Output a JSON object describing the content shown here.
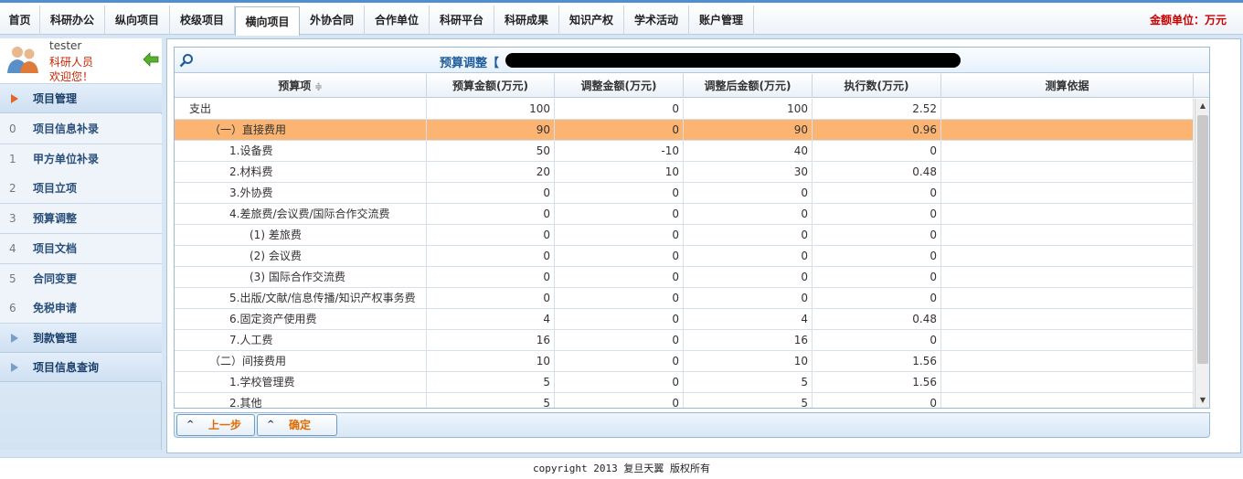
{
  "nav": {
    "tabs": [
      {
        "label": "首页"
      },
      {
        "label": "科研办公"
      },
      {
        "label": "纵向项目"
      },
      {
        "label": "校级项目"
      },
      {
        "label": "横向项目"
      },
      {
        "label": "外协合同"
      },
      {
        "label": "合作单位"
      },
      {
        "label": "科研平台"
      },
      {
        "label": "科研成果"
      },
      {
        "label": "知识产权"
      },
      {
        "label": "学术活动"
      },
      {
        "label": "账户管理"
      }
    ],
    "active_index": 4,
    "unit_label": "金额单位：万元"
  },
  "user": {
    "name": "tester",
    "role": "科研人员",
    "welcome": "欢迎您！"
  },
  "sidebar": {
    "section1": "项目管理",
    "items": [
      {
        "idx": "0",
        "label": "项目信息补录"
      },
      {
        "idx": "1",
        "label": "甲方单位补录"
      },
      {
        "idx": "2",
        "label": "项目立项"
      },
      {
        "idx": "3",
        "label": "预算调整"
      },
      {
        "idx": "4",
        "label": "项目文档"
      },
      {
        "idx": "5",
        "label": "合同变更"
      },
      {
        "idx": "6",
        "label": "免税申请"
      }
    ],
    "section2": "到款管理",
    "section3": "项目信息查询"
  },
  "grid": {
    "title": "预算调整【",
    "columns": [
      "预算项",
      "预算金额(万元)",
      "调整金额(万元)",
      "调整后金额(万元)",
      "执行数(万元)",
      "测算依据"
    ],
    "sort_icon": "≑",
    "rows": [
      {
        "item": "支出",
        "budget": "100",
        "adjust": "0",
        "after": "100",
        "exec": "2.52",
        "basis": "",
        "indent": 0
      },
      {
        "item": "（一）直接费用",
        "budget": "90",
        "adjust": "0",
        "after": "90",
        "exec": "0.96",
        "basis": "",
        "indent": 1
      },
      {
        "item": "1.设备费",
        "budget": "50",
        "adjust": "-10",
        "after": "40",
        "exec": "0",
        "basis": "",
        "indent": 2
      },
      {
        "item": "2.材料费",
        "budget": "20",
        "adjust": "10",
        "after": "30",
        "exec": "0.48",
        "basis": "",
        "indent": 2
      },
      {
        "item": "3.外协费",
        "budget": "0",
        "adjust": "0",
        "after": "0",
        "exec": "0",
        "basis": "",
        "indent": 2
      },
      {
        "item": "4.差旅费/会议费/国际合作交流费",
        "budget": "0",
        "adjust": "0",
        "after": "0",
        "exec": "0",
        "basis": "",
        "indent": 2
      },
      {
        "item": "(1) 差旅费",
        "budget": "0",
        "adjust": "0",
        "after": "0",
        "exec": "0",
        "basis": "",
        "indent": 3
      },
      {
        "item": "(2) 会议费",
        "budget": "0",
        "adjust": "0",
        "after": "0",
        "exec": "0",
        "basis": "",
        "indent": 3
      },
      {
        "item": "(3) 国际合作交流费",
        "budget": "0",
        "adjust": "0",
        "after": "0",
        "exec": "0",
        "basis": "",
        "indent": 3
      },
      {
        "item": "5.出版/文献/信息传播/知识产权事务费",
        "budget": "0",
        "adjust": "0",
        "after": "0",
        "exec": "0",
        "basis": "",
        "indent": 2
      },
      {
        "item": "6.固定资产使用费",
        "budget": "4",
        "adjust": "0",
        "after": "4",
        "exec": "0.48",
        "basis": "",
        "indent": 2
      },
      {
        "item": "7.人工费",
        "budget": "16",
        "adjust": "0",
        "after": "16",
        "exec": "0",
        "basis": "",
        "indent": 2
      },
      {
        "item": "（二）间接费用",
        "budget": "10",
        "adjust": "0",
        "after": "10",
        "exec": "1.56",
        "basis": "",
        "indent": 1
      },
      {
        "item": "1.学校管理费",
        "budget": "5",
        "adjust": "0",
        "after": "5",
        "exec": "1.56",
        "basis": "",
        "indent": 2
      },
      {
        "item": "2.其他",
        "budget": "5",
        "adjust": "0",
        "after": "5",
        "exec": "0",
        "basis": "",
        "indent": 2
      }
    ],
    "selected_index": 1
  },
  "buttons": {
    "prev": "上一步",
    "confirm": "确定"
  },
  "footer": "copyright 2013 复旦天翼 版权所有",
  "colors": {
    "selected_row": "#fcb473",
    "accent": "#1f5d9a",
    "alert": "#cc0000"
  }
}
